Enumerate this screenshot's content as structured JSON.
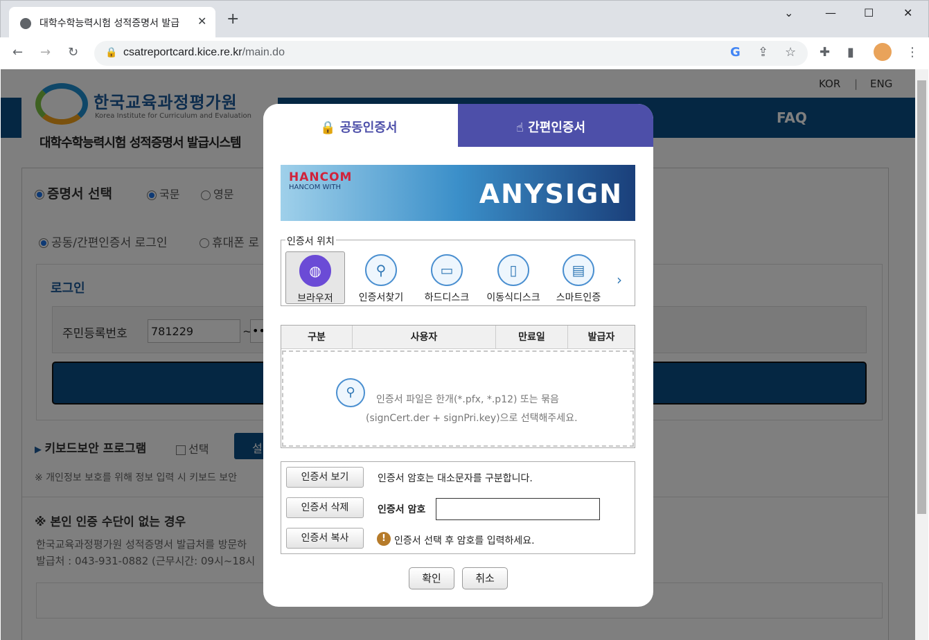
{
  "browser": {
    "tab_title": "대학수학능력시험 성적증명서 발급",
    "url_domain": "csatreportcard.kice.re.kr",
    "url_path": "/main.do"
  },
  "site": {
    "org_name": "한국교육과정평가원",
    "org_name_en": "Korea Institute for Curriculum and Evaluation",
    "system_title": "대학수학능력시험 성적증명서 발급시스템",
    "lang_kor": "KOR",
    "lang_sep": "|",
    "lang_eng": "ENG",
    "nav_faq": "FAQ"
  },
  "page": {
    "cert_select_heading": "증명서 선택",
    "lang_korean": "국문",
    "lang_english": "영문",
    "login_method_1": "공동/간편인증서 로그인",
    "login_method_2": "휴대폰 로",
    "login_heading": "로그인",
    "rrn_label": "주민등록번호",
    "rrn_value": "781229",
    "rrn_sep": "~",
    "rrn_masked": "•••",
    "keyboard_security": "키보드보안 프로그램",
    "select_label": "선택",
    "install_btn": "설",
    "privacy_note": "※ 개인정보 보호를 위해 정보 입력 시 키보드 보안",
    "no_auth_heading": "※ 본인 인증 수단이 없는 경우",
    "no_auth_text_1": "한국교육과정평가원 성적증명서 발급처를 방문하",
    "no_auth_text_2": "발급처 : 043-931-0882 (근무시간: 09시~18시"
  },
  "dialog": {
    "tab_joint_cert": "공동인증서",
    "tab_simple_cert": "간편인증서",
    "banner_brand": "HANCOM",
    "banner_sub": "HANCOM WITH",
    "banner_product": "ANYSIGN",
    "location_legend": "인증서 위치",
    "locations": [
      {
        "label": "브라우저",
        "icon": "globe-icon"
      },
      {
        "label": "인증서찾기",
        "icon": "magnifier-icon"
      },
      {
        "label": "하드디스크",
        "icon": "monitor-icon"
      },
      {
        "label": "이동식디스크",
        "icon": "usb-icon"
      },
      {
        "label": "스마트인증",
        "icon": "smartphone-icon"
      }
    ],
    "table_headers": [
      "구분",
      "사용자",
      "만료일",
      "발급자"
    ],
    "dropzone_text_1": "인증서 파일은 한개(*.pfx, *.p12) 또는 묶음",
    "dropzone_text_2": "(signCert.der + signPri.key)으로 선택해주세요.",
    "btn_view": "인증서 보기",
    "btn_delete": "인증서 삭제",
    "btn_copy": "인증서 복사",
    "case_note": "인증서 암호는 대소문자를 구분합니다.",
    "pw_label": "인증서 암호",
    "pw_value": "",
    "warn_text": "인증서 선택 후 암호를 입력하세요.",
    "btn_ok": "확인",
    "btn_cancel": "취소"
  },
  "colors": {
    "accent": "#4d4fa9",
    "header_blue": "#0b4e87"
  }
}
